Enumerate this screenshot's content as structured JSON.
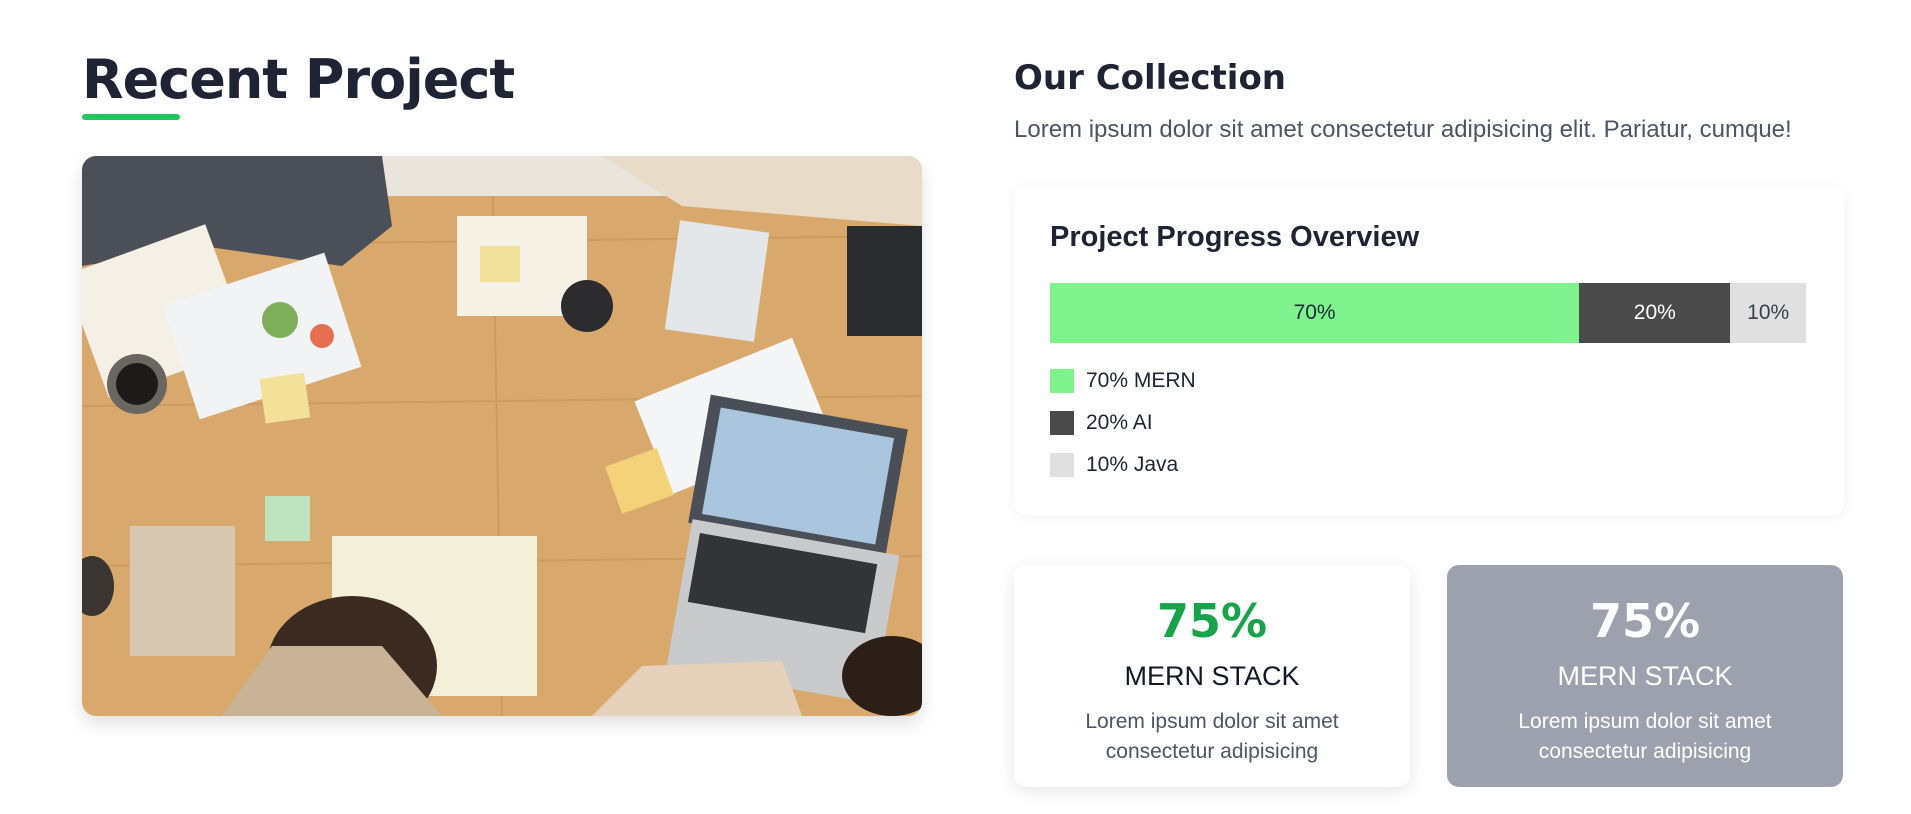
{
  "recent_project": {
    "title": "Recent Project",
    "image_alt": "Team working at a wooden table with laptop, notebooks and charts"
  },
  "collection": {
    "title": "Our Collection",
    "description": "Lorem ipsum dolor sit amet consectetur adipisicing elit. Pariatur, cumque!"
  },
  "progress": {
    "title": "Project Progress Overview",
    "segments": [
      {
        "label": "70%",
        "value": 70,
        "color": "#7df28d"
      },
      {
        "label": "20%",
        "value": 20,
        "color": "#4a4a4a"
      },
      {
        "label": "10%",
        "value": 10,
        "color": "#e0e0e0"
      }
    ],
    "legend": [
      {
        "label": "70% MERN",
        "color": "#7df28d"
      },
      {
        "label": "20% AI",
        "color": "#4a4a4a"
      },
      {
        "label": "10% Java",
        "color": "#e0e0e0"
      }
    ]
  },
  "stats": [
    {
      "value": "75%",
      "name": "MERN STACK",
      "desc": "Lorem ipsum dolor sit amet consectetur adipisicing"
    },
    {
      "value": "75%",
      "name": "MERN STACK",
      "desc": "Lorem ipsum dolor sit amet consectetur adipisicing"
    }
  ],
  "colors": {
    "accent": "#22c55e",
    "stat_green": "#16a34a",
    "dark_card": "#9ca1ad"
  }
}
